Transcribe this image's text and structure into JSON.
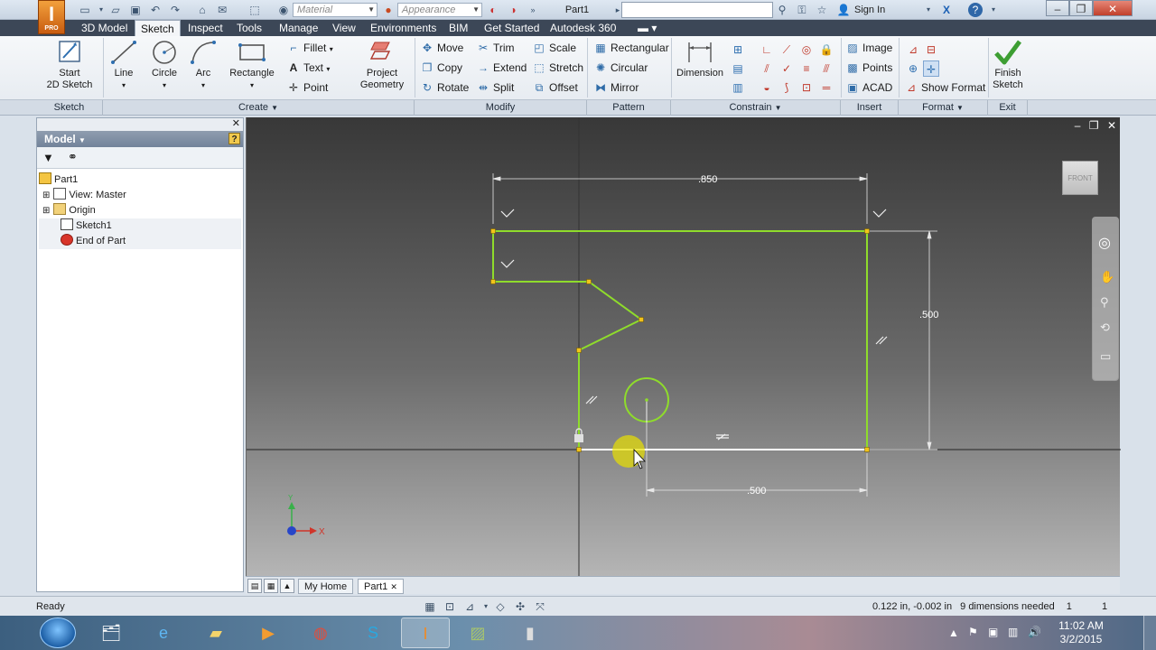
{
  "app": {
    "logo_letter": "I",
    "logo_sub": "PRO",
    "document_title": "Part1",
    "material_placeholder": "Material",
    "appearance_placeholder": "Appearance",
    "sign_in": "Sign In"
  },
  "ribbon_tabs": [
    "3D Model",
    "Sketch",
    "Inspect",
    "Tools",
    "Manage",
    "View",
    "Environments",
    "BIM",
    "Get Started",
    "Autodesk 360"
  ],
  "active_tab": "Sketch",
  "ribbon": {
    "sketch_panel": {
      "start_line1": "Start",
      "start_line2": "2D Sketch",
      "label": "Sketch"
    },
    "create_panel": {
      "label": "Create",
      "line": "Line",
      "circle": "Circle",
      "arc": "Arc",
      "rectangle": "Rectangle",
      "fillet": "Fillet",
      "text": "Text",
      "point": "Point",
      "project_line1": "Project",
      "project_line2": "Geometry"
    },
    "modify_panel": {
      "label": "Modify",
      "move": "Move",
      "copy": "Copy",
      "rotate": "Rotate",
      "trim": "Trim",
      "extend": "Extend",
      "split": "Split",
      "scale": "Scale",
      "stretch": "Stretch",
      "offset": "Offset"
    },
    "pattern_panel": {
      "label": "Pattern",
      "rectangular": "Rectangular",
      "circular": "Circular",
      "mirror": "Mirror"
    },
    "constrain_panel": {
      "label": "Constrain",
      "dimension": "Dimension"
    },
    "insert_panel": {
      "label": "Insert",
      "image": "Image",
      "points": "Points",
      "acad": "ACAD"
    },
    "format_panel": {
      "label": "Format",
      "show_format": "Show Format"
    },
    "exit_panel": {
      "label": "Exit",
      "finish_line1": "Finish",
      "finish_line2": "Sketch"
    }
  },
  "browser": {
    "title": "Model",
    "tree": [
      {
        "label": "Part1",
        "icon": "part-icon"
      },
      {
        "label": "View: Master",
        "icon": "view-icon"
      },
      {
        "label": "Origin",
        "icon": "folder-icon"
      },
      {
        "label": "Sketch1",
        "icon": "sketch-icon"
      },
      {
        "label": "End of Part",
        "icon": "end-of-part-icon"
      }
    ]
  },
  "viewport": {
    "viewcube_label": "FRONT",
    "dimensions": [
      {
        "value": ".850"
      },
      {
        "value": ".500"
      },
      {
        "value": ".500"
      }
    ],
    "axis_x": "X",
    "axis_y": "Y"
  },
  "doc_tabs": [
    "My Home",
    "Part1"
  ],
  "status": {
    "left": "Ready",
    "coords": "0.122 in, -0.002 in",
    "dims_needed": "9 dimensions needed",
    "num1": "1",
    "num2": "1"
  },
  "taskbar": {
    "time": "11:02 AM",
    "date": "3/2/2015"
  },
  "colors": {
    "sketch_line": "#8fdc2b",
    "sketch_point": "#f2c31a",
    "ribbon_tab_bg": "#3c4757",
    "highlight_cursor": "#e8e000"
  }
}
